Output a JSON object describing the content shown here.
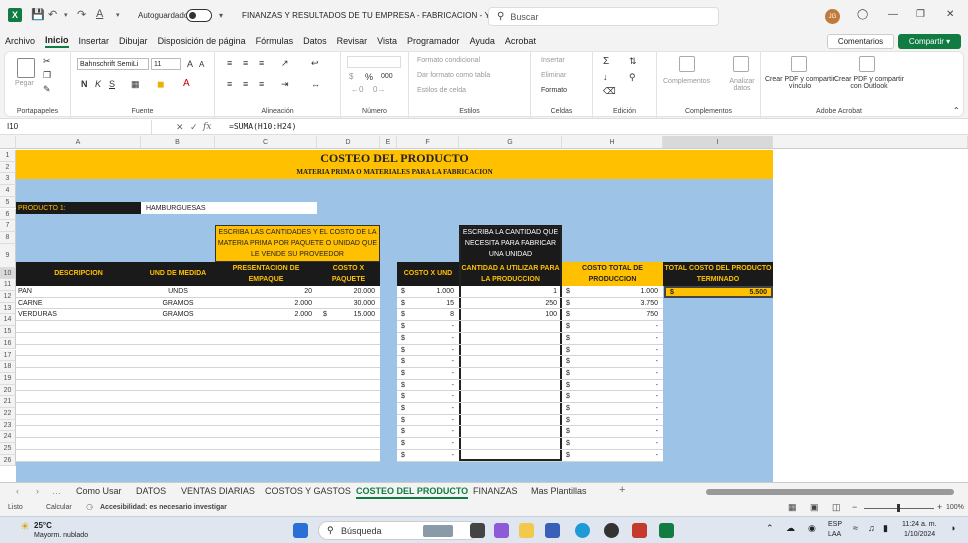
{
  "titlebar": {
    "autosave_label": "Autoguardado",
    "doc_title": "FINANZAS Y RESULTADOS DE TU EMPRESA - FABRICACION - Y...",
    "search_placeholder": "Buscar",
    "avatar_initials": "JG"
  },
  "menu": [
    "Archivo",
    "Inicio",
    "Insertar",
    "Dibujar",
    "Disposición de página",
    "Fórmulas",
    "Datos",
    "Revisar",
    "Vista",
    "Programador",
    "Ayuda",
    "Acrobat"
  ],
  "menu_active": "Inicio",
  "comments_label": "Comentarios",
  "share_label": "Compartir",
  "ribbon": {
    "clipboard": {
      "paste": "Pegar",
      "label": "Portapapeles"
    },
    "font": {
      "name": "Bahnschrift SemiLi",
      "size": "11",
      "label": "Fuente",
      "bold": "N",
      "italic": "K",
      "underline": "S"
    },
    "alignment": {
      "label": "Alineación"
    },
    "number": {
      "label": "Número",
      "percent": "%",
      "thousands": "000"
    },
    "styles": {
      "cond": "Formato condicional",
      "table": "Dar formato como tabla",
      "cell": "Estilos de celda",
      "label": "Estilos"
    },
    "cells": {
      "insert": "Insertar",
      "delete": "Eliminar",
      "format": "Formato",
      "label": "Celdas"
    },
    "editing": {
      "label": "Edición"
    },
    "addins": {
      "complements": "Complementos",
      "analyze": "Analizar datos",
      "label": "Complementos"
    },
    "acrobat": {
      "pdf_link": "Crear PDF y compartir vínculo",
      "pdf_outlook": "Crear PDF y compartir con Outlook",
      "label": "Adobe Acrobat"
    }
  },
  "formula_bar": {
    "name_box": "I10",
    "formula": "=SUMA(H10:H24)"
  },
  "columns": [
    "A",
    "B",
    "C",
    "D",
    "E",
    "F",
    "G",
    "H",
    "I"
  ],
  "rows": [
    "1",
    "2",
    "3",
    "4",
    "5",
    "6",
    "7",
    "8",
    "9",
    "10",
    "11",
    "12",
    "13",
    "14",
    "15",
    "16",
    "17",
    "18",
    "19",
    "20",
    "21",
    "22",
    "23",
    "24",
    "25",
    "26"
  ],
  "sheet": {
    "title": "COSTEO DEL PRODUCTO",
    "subtitle": "MATERIA PRIMA O MATERIALES PARA LA FABRICACION",
    "product_label": "PRODUCTO 1:",
    "product_value": "HAMBURGUESAS",
    "note_left": "ESCRIBA LAS CANTIDADES Y EL COSTO DE LA MATERIA PRIMA POR PAQUETE O UNIDAD QUE LE VENDE SU PROVEEDOR",
    "note_right": "ESCRIBA LA CANTIDAD QUE NECESITA PARA FABRICAR UNA UNIDAD",
    "headers": {
      "descripcion": "DESCRIPCION",
      "unidad": "UND DE MEDIDA",
      "presentacion": "PRESENTACION DE EMPAQUE",
      "costo_paquete": "COSTO X PAQUETE",
      "costo_und": "COSTO X UND",
      "cantidad": "CANTIDAD A UTILIZAR PARA LA PRODUCCION",
      "costo_total": "COSTO TOTAL DE PRODUCCION",
      "total_costo": "TOTAL COSTO DEL PRODUCTO TERMINADO"
    },
    "currency": "$",
    "dash": "-",
    "total_value": "5.500",
    "items": [
      {
        "desc": "PAN",
        "unit": "UNDS",
        "pres": "20",
        "cost_pkg": "20.000",
        "cost_pkg_sym": "",
        "cost_und": "1.000",
        "qty": "1",
        "total": "1.000"
      },
      {
        "desc": "CARNE",
        "unit": "GRAMOS",
        "pres": "2.000",
        "cost_pkg": "30.000",
        "cost_pkg_sym": "",
        "cost_und": "15",
        "qty": "250",
        "total": "3.750"
      },
      {
        "desc": "VERDURAS",
        "unit": "GRAMOS",
        "pres": "2.000",
        "cost_pkg": "15.000",
        "cost_pkg_sym": "$",
        "cost_und": "8",
        "qty": "100",
        "total": "750"
      }
    ]
  },
  "sheet_tabs": [
    "Como Usar",
    "DATOS",
    "VENTAS DIARIAS",
    "COSTOS Y GASTOS",
    "COSTEO DEL PRODUCTO",
    "FINANZAS",
    "Mas Plantillas"
  ],
  "sheet_tab_active": "COSTEO DEL PRODUCTO",
  "status": {
    "ready": "Listo",
    "calc": "Calcular",
    "accessibility": "Accesibilidad: es necesario investigar",
    "zoom": "100%"
  },
  "taskbar": {
    "temp": "25°C",
    "weather": "Mayorm. nublado",
    "search": "Búsqueda",
    "lang1": "ESP",
    "lang2": "LAA",
    "time": "11:24 a. m.",
    "date": "1/10/2024"
  }
}
